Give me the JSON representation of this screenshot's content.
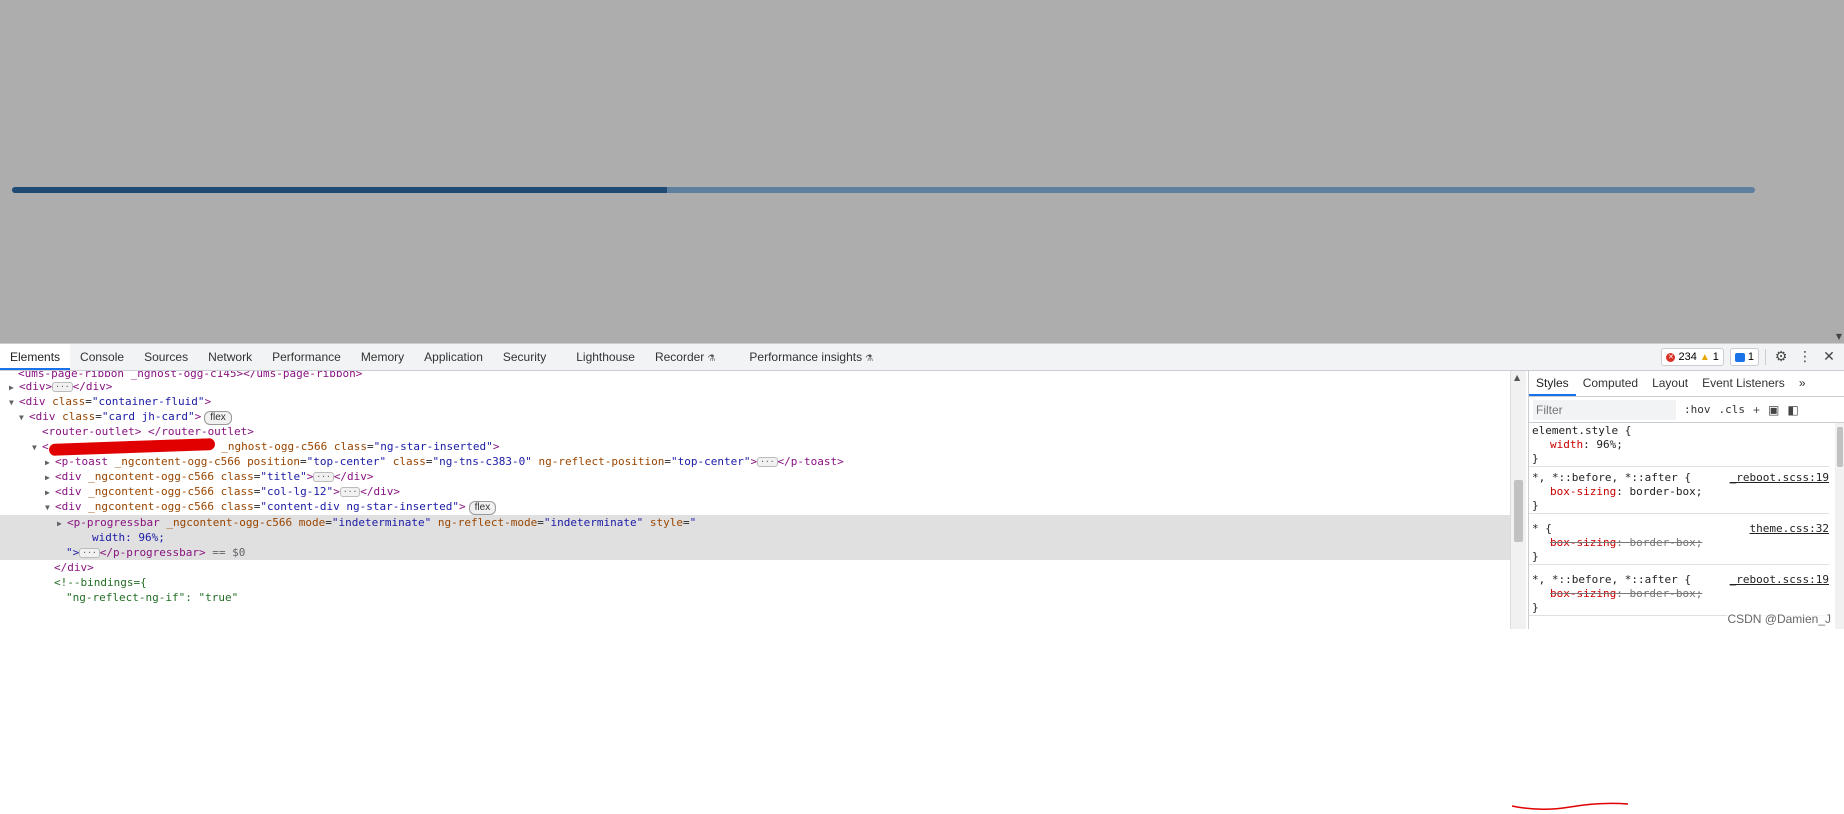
{
  "progressbar": {
    "value_percent": 37.6
  },
  "devtools": {
    "tabs": [
      "Elements",
      "Console",
      "Sources",
      "Network",
      "Performance",
      "Memory",
      "Application",
      "Security",
      "Lighthouse",
      "Recorder",
      "Performance insights"
    ],
    "errors": "234",
    "warnings": "1",
    "messages": "1"
  },
  "elements_tree": {
    "l0_tag": "<ums-page-ribbon _nghost-ogg-c145></ums-page-ribbon>",
    "l1_open": "<div>",
    "l1_close": "</div>",
    "l2_tag": "<div ",
    "l2_attr": "class",
    "l2_val": "\"container-fluid\"",
    "l3_attr": "class",
    "l3_val": "\"card jh-card\"",
    "flex": "flex",
    "l4_tag": "<router-outlet> </router-outlet>",
    "l5_attr1": " _nghost-ogg-c566 ",
    "l5_attr2": "class",
    "l5_val": "\"ng-star-inserted\"",
    "l6_tag": "<p-toast ",
    "l6_a1": "_ngcontent-ogg-c566 ",
    "l6_a2": "position",
    "l6_v2": "\"top-center\"",
    "l6_a3": "class",
    "l6_v3": "\"ng-tns-c383-0\"",
    "l6_a4": "ng-reflect-position",
    "l6_v4": "\"top-center\"",
    "l6_close": "</p-toast>",
    "l7_val": "\"title\"",
    "l8_val": "\"col-lg-12\"",
    "l9_val": "\"content-div ng-star-inserted\"",
    "ngc": "_ngcontent-ogg-c566 ",
    "l10_tag": "<p-progressbar ",
    "l10_a2": "mode",
    "l10_v2": "\"indeterminate\"",
    "l10_a3": "ng-reflect-mode",
    "l10_v3": "\"indeterminate\"",
    "l10_a4": "style",
    "l10_v4": "\"",
    "l11_text": "width: 96%;",
    "l12_quote": "\">",
    "l12_close": "</p-progressbar>",
    "l12_dollar": " == $0",
    "l13_close": "</div>",
    "l14_comment": "<!--bindings={",
    "l15_comment": "\"ng-reflect-ng-if\": \"true\""
  },
  "styles_pane": {
    "tabs": [
      "Styles",
      "Computed",
      "Layout",
      "Event Listeners"
    ],
    "more": "»",
    "filter_placeholder": "Filter",
    "hov": ":hov",
    "cls": ".cls",
    "rules": [
      {
        "selector": "element.style {",
        "prop": "width",
        "value": "96%;",
        "close": "}"
      },
      {
        "selector": "*, *::before, *::after {",
        "source": "_reboot.scss:19",
        "prop": "box-sizing",
        "value": "border-box;",
        "close": "}"
      },
      {
        "selector": "* {",
        "source": "theme.css:32",
        "prop": "box-sizing",
        "value": "border-box;",
        "close": "}"
      },
      {
        "selector": "*, *::before, *::after {",
        "source": "_reboot.scss:19",
        "prop": "box-sizing",
        "value": "border-box;",
        "close": "}"
      }
    ]
  },
  "watermark": "CSDN @Damien_J",
  "colors": {
    "page_bg": "#adadad",
    "progress_track": "#5f7f9e",
    "progress_fill": "#1f4a73",
    "accent": "#1a73e8",
    "annotation": "#e00000"
  }
}
